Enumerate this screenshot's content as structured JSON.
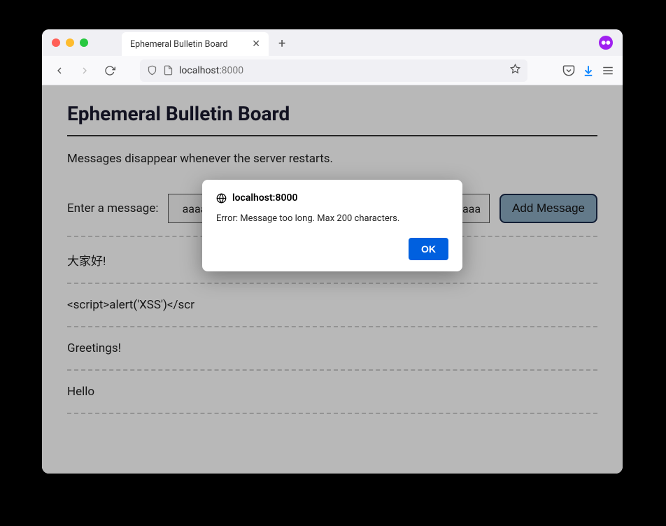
{
  "browser": {
    "tab_title": "Ephemeral Bulletin Board",
    "url_host": "localhost:",
    "url_port": "8000"
  },
  "page": {
    "title": "Ephemeral Bulletin Board",
    "subtitle": "Messages disappear whenever the server restarts.",
    "form_label": "Enter a message:",
    "input_value": "aaaaaaaaaaaaaaaaaaaaaaaaaaaaaaaaaaaaaaaaaaaaaaaaa",
    "submit_label": "Add Message"
  },
  "messages": [
    "大家好!",
    "<script>alert('XSS')</scr",
    "Greetings!",
    "Hello"
  ],
  "alert": {
    "origin": "localhost:8000",
    "message": "Error: Message too long.  Max 200 characters.",
    "ok_label": "OK"
  }
}
